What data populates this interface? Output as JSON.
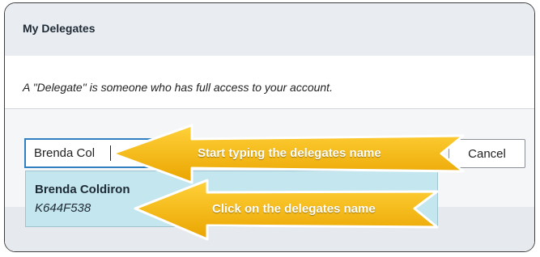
{
  "panel": {
    "title": "My Delegates",
    "description": "A \"Delegate\" is someone who has full access to your account."
  },
  "search": {
    "value": "Brenda Col",
    "placeholder": ""
  },
  "cancel_label": "Cancel",
  "suggestion": {
    "name": "Brenda Coldiron",
    "id": "K644F538"
  },
  "callouts": {
    "typing_hint": "Start typing the delegates name",
    "click_hint": "Click on the delegates name"
  },
  "colors": {
    "accent": "#2f7fc1",
    "arrow_fill": "#f5b800",
    "suggestion_bg": "#c4e6ee"
  }
}
